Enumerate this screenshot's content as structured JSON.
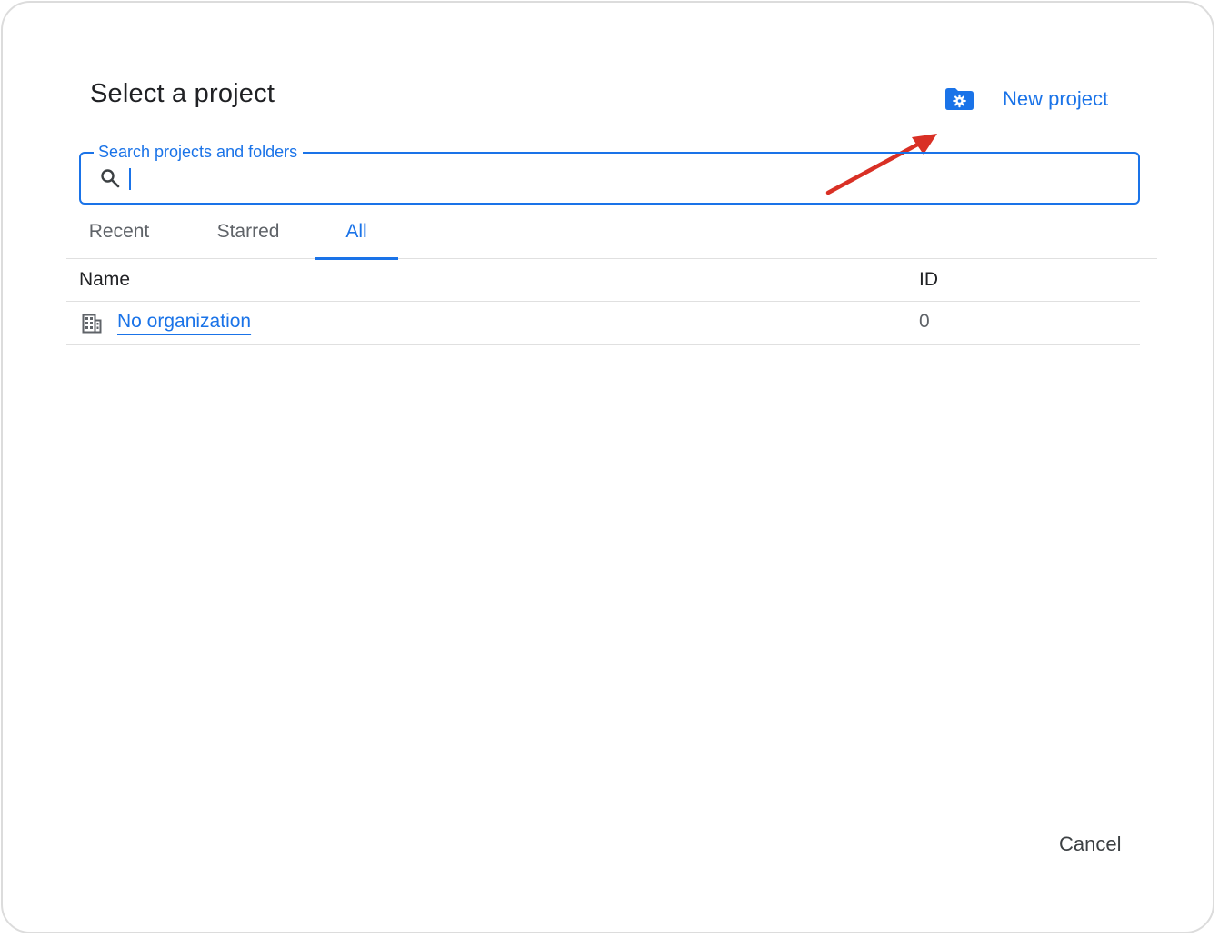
{
  "dialog": {
    "title": "Select a project",
    "new_project_label": "New project",
    "search": {
      "label": "Search projects and folders",
      "value": ""
    },
    "tabs": [
      {
        "label": "Recent",
        "selected": false
      },
      {
        "label": "Starred",
        "selected": false
      },
      {
        "label": "All",
        "selected": true
      }
    ],
    "table": {
      "columns": [
        "Name",
        "ID"
      ],
      "rows": [
        {
          "name": "No organization",
          "id": "0",
          "icon": "organization-icon"
        }
      ]
    },
    "cancel_label": "Cancel"
  },
  "colors": {
    "accent": "#1a73e8",
    "annotation_arrow": "#d93025",
    "text_primary": "#202124",
    "text_secondary": "#5f6368",
    "divider": "#e0e0e0"
  },
  "icons": {
    "new_project": "folder-gear-icon",
    "search": "search-icon",
    "organization": "organization-icon"
  }
}
